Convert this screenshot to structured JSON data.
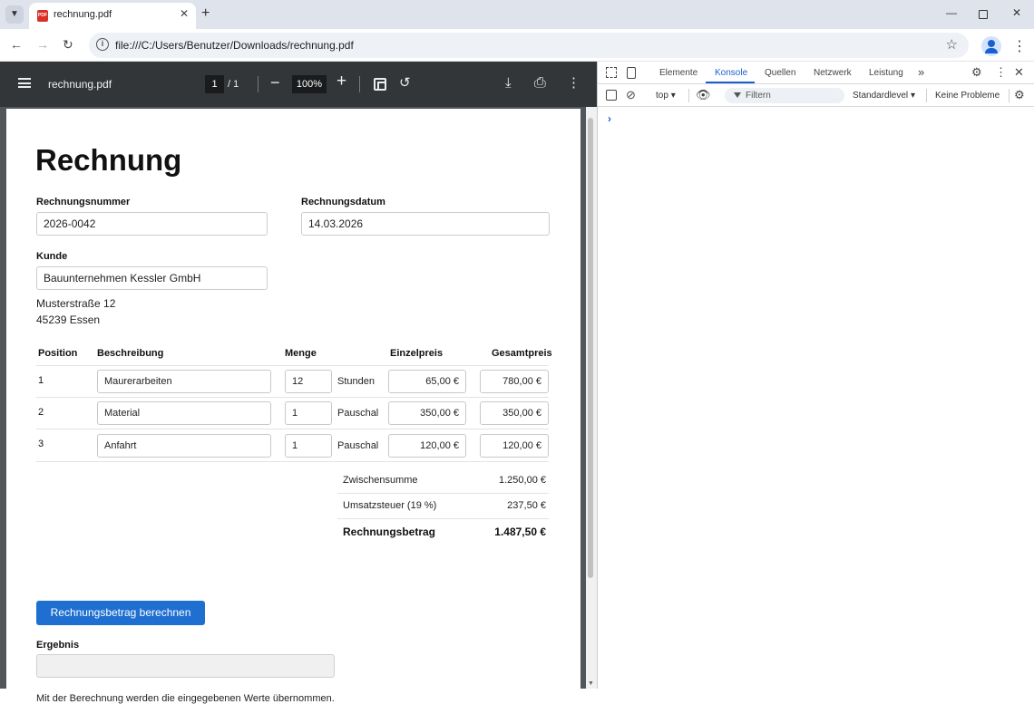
{
  "browser": {
    "tab_title": "rechnung.pdf",
    "favicon_text": "PDF",
    "url": "file:///C:/Users/Benutzer/Downloads/rechnung.pdf"
  },
  "pdf_viewer": {
    "filename": "rechnung.pdf",
    "page_current": "1",
    "page_total": "/  1",
    "zoom": "100%"
  },
  "invoice": {
    "title": "Rechnung",
    "number_label": "Rechnungsnummer",
    "number_value": "2026-0042",
    "date_label": "Rechnungsdatum",
    "date_value": "14.03.2026",
    "customer_label": "Kunde",
    "customer_value": "Bauunternehmen Kessler GmbH",
    "address_line1": "Musterstraße 12",
    "address_line2": "45239 Essen",
    "columns": {
      "position": "Position",
      "description": "Beschreibung",
      "quantity": "Menge",
      "unit_price": "Einzelpreis",
      "total_price": "Gesamtpreis"
    },
    "items": [
      {
        "pos": "1",
        "description": "Maurerarbeiten",
        "qty": "12",
        "unit": "Stunden",
        "unit_price": "65,00 €",
        "total": "780,00 €"
      },
      {
        "pos": "2",
        "description": "Material",
        "qty": "1",
        "unit": "Pauschal",
        "unit_price": "350,00 €",
        "total": "350,00 €"
      },
      {
        "pos": "3",
        "description": "Anfahrt",
        "qty": "1",
        "unit": "Pauschal",
        "unit_price": "120,00 €",
        "total": "120,00 €"
      }
    ],
    "subtotal_label": "Zwischensumme",
    "subtotal_value": "1.250,00 €",
    "vat_label": "Umsatzsteuer (19 %)",
    "vat_value": "237,50 €",
    "grand_total_label": "Rechnungsbetrag",
    "grand_total_value": "1.487,50 €",
    "calc_button": "Rechnungsbetrag berechnen",
    "result_label": "Ergebnis",
    "result_value": "",
    "note": "Mit der Berechnung werden die eingegebenen Werte übernommen."
  },
  "devtools": {
    "tabs": [
      "Elemente",
      "Konsole",
      "Quellen",
      "Netzwerk",
      "Leistung"
    ],
    "active_tab": "Konsole",
    "context": "top",
    "filter_placeholder": "Filtern",
    "level": "Standardlevel",
    "issues": "Keine Probleme",
    "prompt": "›"
  },
  "colors": {
    "accent": "#1f6fd1",
    "pdf_toolbar": "#323639",
    "pdf_background": "#525659",
    "chrome_tabstrip": "#dfe3ec"
  }
}
